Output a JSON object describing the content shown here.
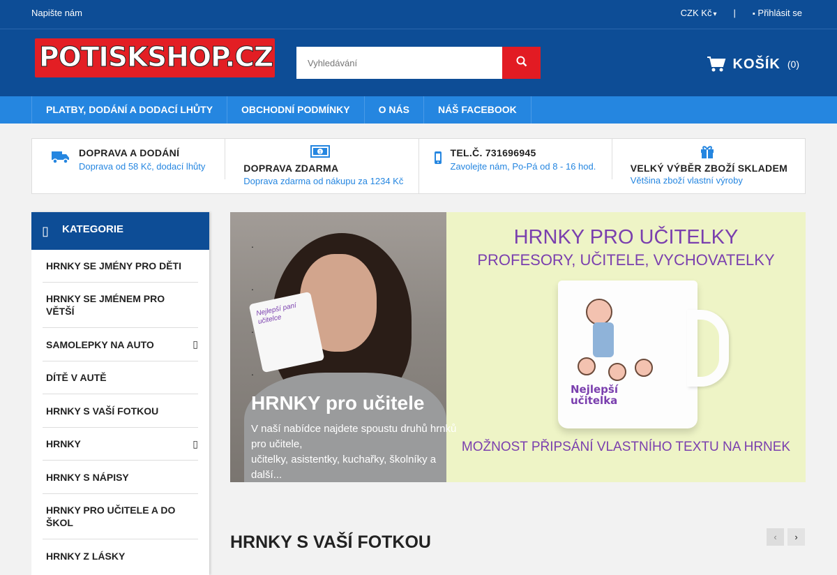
{
  "topbar": {
    "contact": "Napište nám",
    "currency": "CZK Kč",
    "divider": "|",
    "login": "Přihlásit se"
  },
  "header": {
    "logo_text": "POTISKSHOP.CZ",
    "search_placeholder": "Vyhledávání",
    "cart_label": "KOŠÍK",
    "cart_count": "(0)"
  },
  "nav": {
    "items": [
      "PLATBY, DODÁNÍ A DODACÍ LHŮTY",
      "OBCHODNÍ PODMÍNKY",
      "O NÁS",
      "NÁŠ FACEBOOK"
    ]
  },
  "features": [
    {
      "icon": "truck-icon",
      "title": "DOPRAVA A DODÁNÍ",
      "subtitle": "Doprava od 58 Kč, dodací lhůty"
    },
    {
      "icon": "money-icon",
      "title": "DOPRAVA ZDARMA",
      "subtitle": "Doprava zdarma od nákupu za 1234 Kč"
    },
    {
      "icon": "phone-icon",
      "title": "TEL.Č. 731696945",
      "subtitle": "Zavolejte nám, Po-Pá od 8 - 16 hod."
    },
    {
      "icon": "gift-icon",
      "title": "VELKÝ VÝBĚR ZBOŽÍ SKLADEM",
      "subtitle": "Většina zboží vlastní výroby"
    }
  ],
  "sidebar": {
    "title": "KATEGORIE",
    "items": [
      {
        "label": "HRNKY SE JMÉNY PRO DĚTI",
        "has_sub": false
      },
      {
        "label": "HRNKY SE JMÉNEM PRO VĚTŠÍ",
        "has_sub": false
      },
      {
        "label": "SAMOLEPKY NA AUTO",
        "has_sub": true
      },
      {
        "label": "DÍTĚ V AUTĚ",
        "has_sub": false
      },
      {
        "label": "HRNKY S VAŠÍ FOTKOU",
        "has_sub": false
      },
      {
        "label": "HRNKY",
        "has_sub": true
      },
      {
        "label": "HRNKY S NÁPISY",
        "has_sub": false
      },
      {
        "label": "HRNKY PRO UČITELE A DO ŠKOL",
        "has_sub": false
      },
      {
        "label": "HRNKY Z LÁSKY",
        "has_sub": false
      }
    ]
  },
  "banner": {
    "headline1": "HRNKY PRO UČITELKY",
    "headline2": "PROFESORY, UČITELE, VYCHOVATELKY",
    "footer_text": "MOŽNOST PŘIPSÁNÍ VLASTNÍHO TEXTU NA HRNEK",
    "mug_text": "Nejlepší učitelka",
    "small_mug_text": "Nejlepší paní učitelce",
    "caption_title": "HRNKY pro učitele",
    "caption_desc_line1": "V naší nabídce najdete spoustu druhů hrnků pro učitele,",
    "caption_desc_line2": "učitelky, asistentky, kuchařky, školníky a další...",
    "dots": [
      ".",
      ".",
      ".",
      "."
    ]
  },
  "section": {
    "title": "HRNKY S VAŠÍ FOTKOU",
    "prev": "‹",
    "next": "›"
  }
}
